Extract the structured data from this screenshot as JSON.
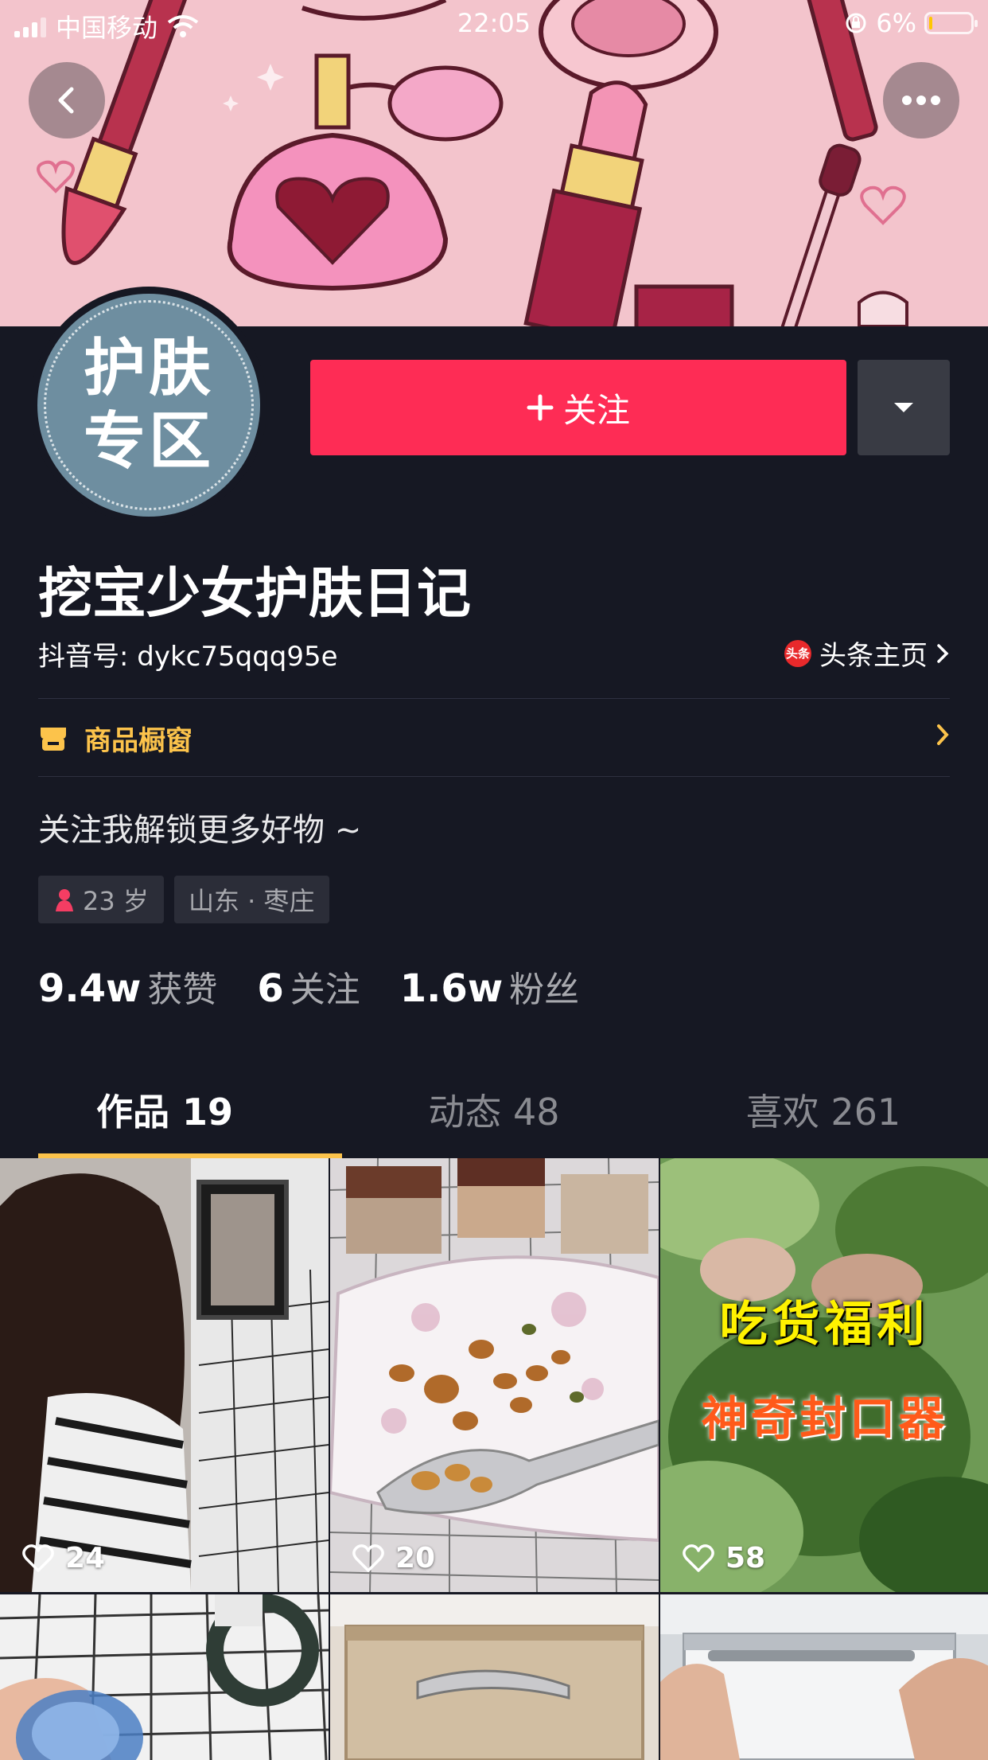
{
  "status_bar": {
    "carrier": "中国移动",
    "time": "22:05",
    "battery_percent": "6%",
    "battery_level": 0.06
  },
  "profile": {
    "avatar_text_line1": "护肤",
    "avatar_text_line2": "专区",
    "nickname": "挖宝少女护肤日记",
    "douyin_id": "抖音号: dykc75qqq95e",
    "toutiao_badge": "头条",
    "toutiao_label": "头条主页",
    "shop_label": "商品橱窗",
    "bio": "关注我解锁更多好物 ~",
    "age_tag": "23 岁",
    "location_tag": "山东 · 枣庄",
    "follow_label": "关注"
  },
  "stats": [
    {
      "value": "9.4w",
      "label": "获赞"
    },
    {
      "value": "6",
      "label": "关注"
    },
    {
      "value": "1.6w",
      "label": "粉丝"
    }
  ],
  "tabs": [
    {
      "label": "作品 19",
      "active": true
    },
    {
      "label": "动态 48",
      "active": false
    },
    {
      "label": "喜欢 261",
      "active": false
    }
  ],
  "videos": [
    {
      "likes": "24"
    },
    {
      "likes": "20"
    },
    {
      "likes": "58",
      "caption_line1": "吃货福利",
      "caption_line2": "神奇封口器"
    }
  ],
  "colors": {
    "background": "#161823",
    "follow_button": "#fe2c55",
    "accent_yellow": "#fcc34b",
    "banner_pink": "#f3c4cc"
  }
}
